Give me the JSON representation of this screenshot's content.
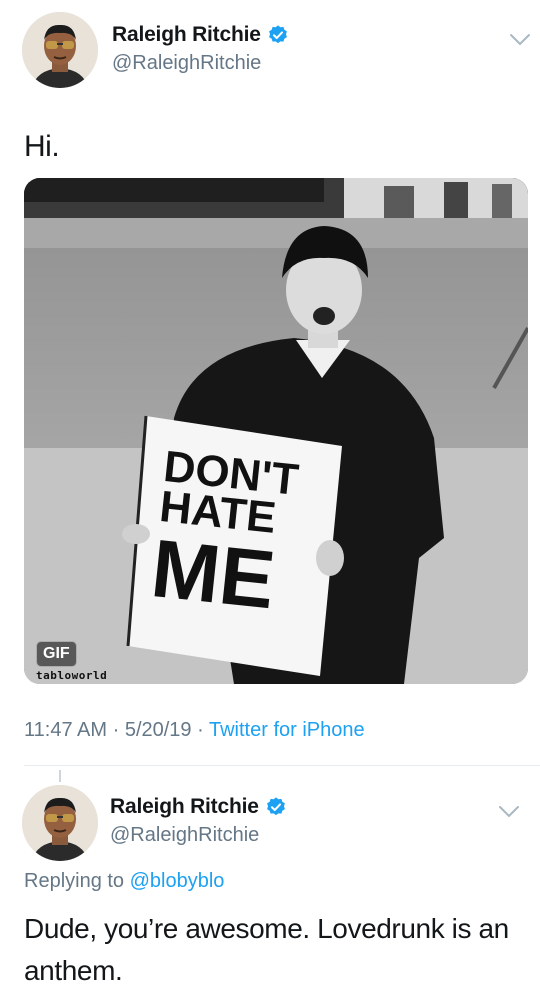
{
  "tweet": {
    "author": {
      "display_name": "Raleigh Ritchie",
      "handle": "@RaleighRitchie",
      "verified": true
    },
    "text": "Hi.",
    "media": {
      "type": "GIF",
      "badge": "GIF",
      "watermark": "tabloworld",
      "sign_lines": [
        "DON'T",
        "HATE",
        "ME"
      ]
    },
    "time": "11:47 AM",
    "date": "5/20/19",
    "source": "Twitter for iPhone",
    "separator": "·"
  },
  "reply": {
    "author": {
      "display_name": "Raleigh Ritchie",
      "handle": "@RaleighRitchie",
      "verified": true
    },
    "replying_prefix": "Replying to",
    "replying_to": "@blobyblo",
    "text": "Dude, you’re awesome. Lovedrunk is an anthem."
  },
  "icons": {
    "verified": "verified-badge-icon",
    "more": "chevron-down-icon"
  },
  "colors": {
    "accent": "#1da1f2",
    "secondary_text": "#657786",
    "primary_text": "#14171a",
    "divider": "#e6ecf0"
  }
}
